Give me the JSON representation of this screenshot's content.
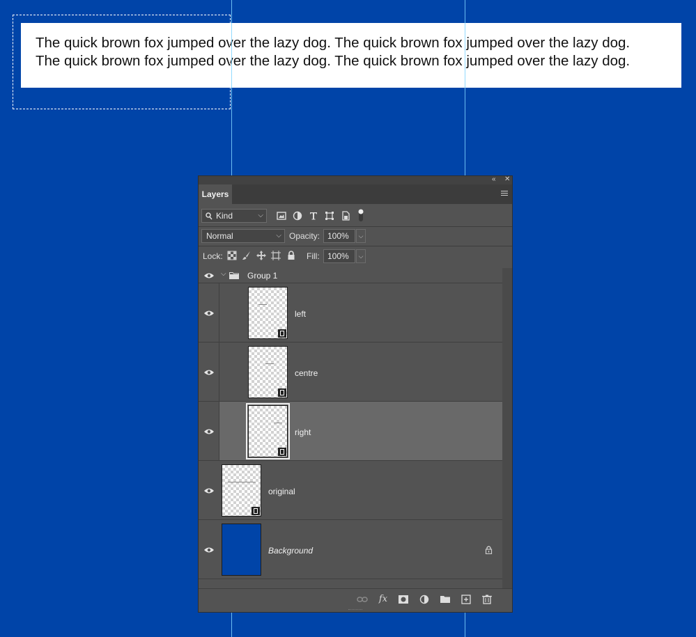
{
  "canvas": {
    "text_lines": [
      "The quick brown fox jumped over the lazy dog. The quick brown fox jumped over the lazy dog.",
      "The quick brown fox jumped over the lazy dog. The quick brown fox jumped over the lazy dog."
    ],
    "background_color": "#0044a8",
    "guide_color": "#7fd4ff"
  },
  "panel": {
    "tab_label": "Layers",
    "filter_kind": "Kind",
    "blend_mode": "Normal",
    "opacity_label": "Opacity:",
    "opacity_value": "100%",
    "lock_label": "Lock:",
    "fill_label": "Fill:",
    "fill_value": "100%",
    "filter_icons": [
      "image-filter-icon",
      "adjustment-filter-icon",
      "type-filter-icon",
      "shape-filter-icon",
      "smart-object-filter-icon",
      "filter-toggle-icon"
    ],
    "lock_icons": [
      "lock-transparent-pixels-icon",
      "lock-image-pixels-icon",
      "lock-position-icon",
      "lock-artboard-icon",
      "lock-all-icon"
    ],
    "layers": [
      {
        "name": "Group 1",
        "type": "group",
        "visible": true,
        "expanded": true
      },
      {
        "name": "left",
        "type": "smart-object",
        "visible": true,
        "indented": true
      },
      {
        "name": "centre",
        "type": "smart-object",
        "visible": true,
        "indented": true
      },
      {
        "name": "right",
        "type": "smart-object",
        "visible": true,
        "indented": true,
        "selected": true
      },
      {
        "name": "original",
        "type": "smart-object",
        "visible": true
      },
      {
        "name": "Background",
        "type": "background",
        "visible": true,
        "locked": true
      }
    ],
    "bottom_icons": [
      "link-layers-icon",
      "layer-style-icon",
      "add-mask-icon",
      "adjustment-layer-icon",
      "new-group-icon",
      "new-layer-icon",
      "delete-layer-icon"
    ],
    "bottom_glyphs": {
      "layer_style": "fx"
    },
    "panel_bg": "#535353",
    "selected_bg": "#696969"
  }
}
